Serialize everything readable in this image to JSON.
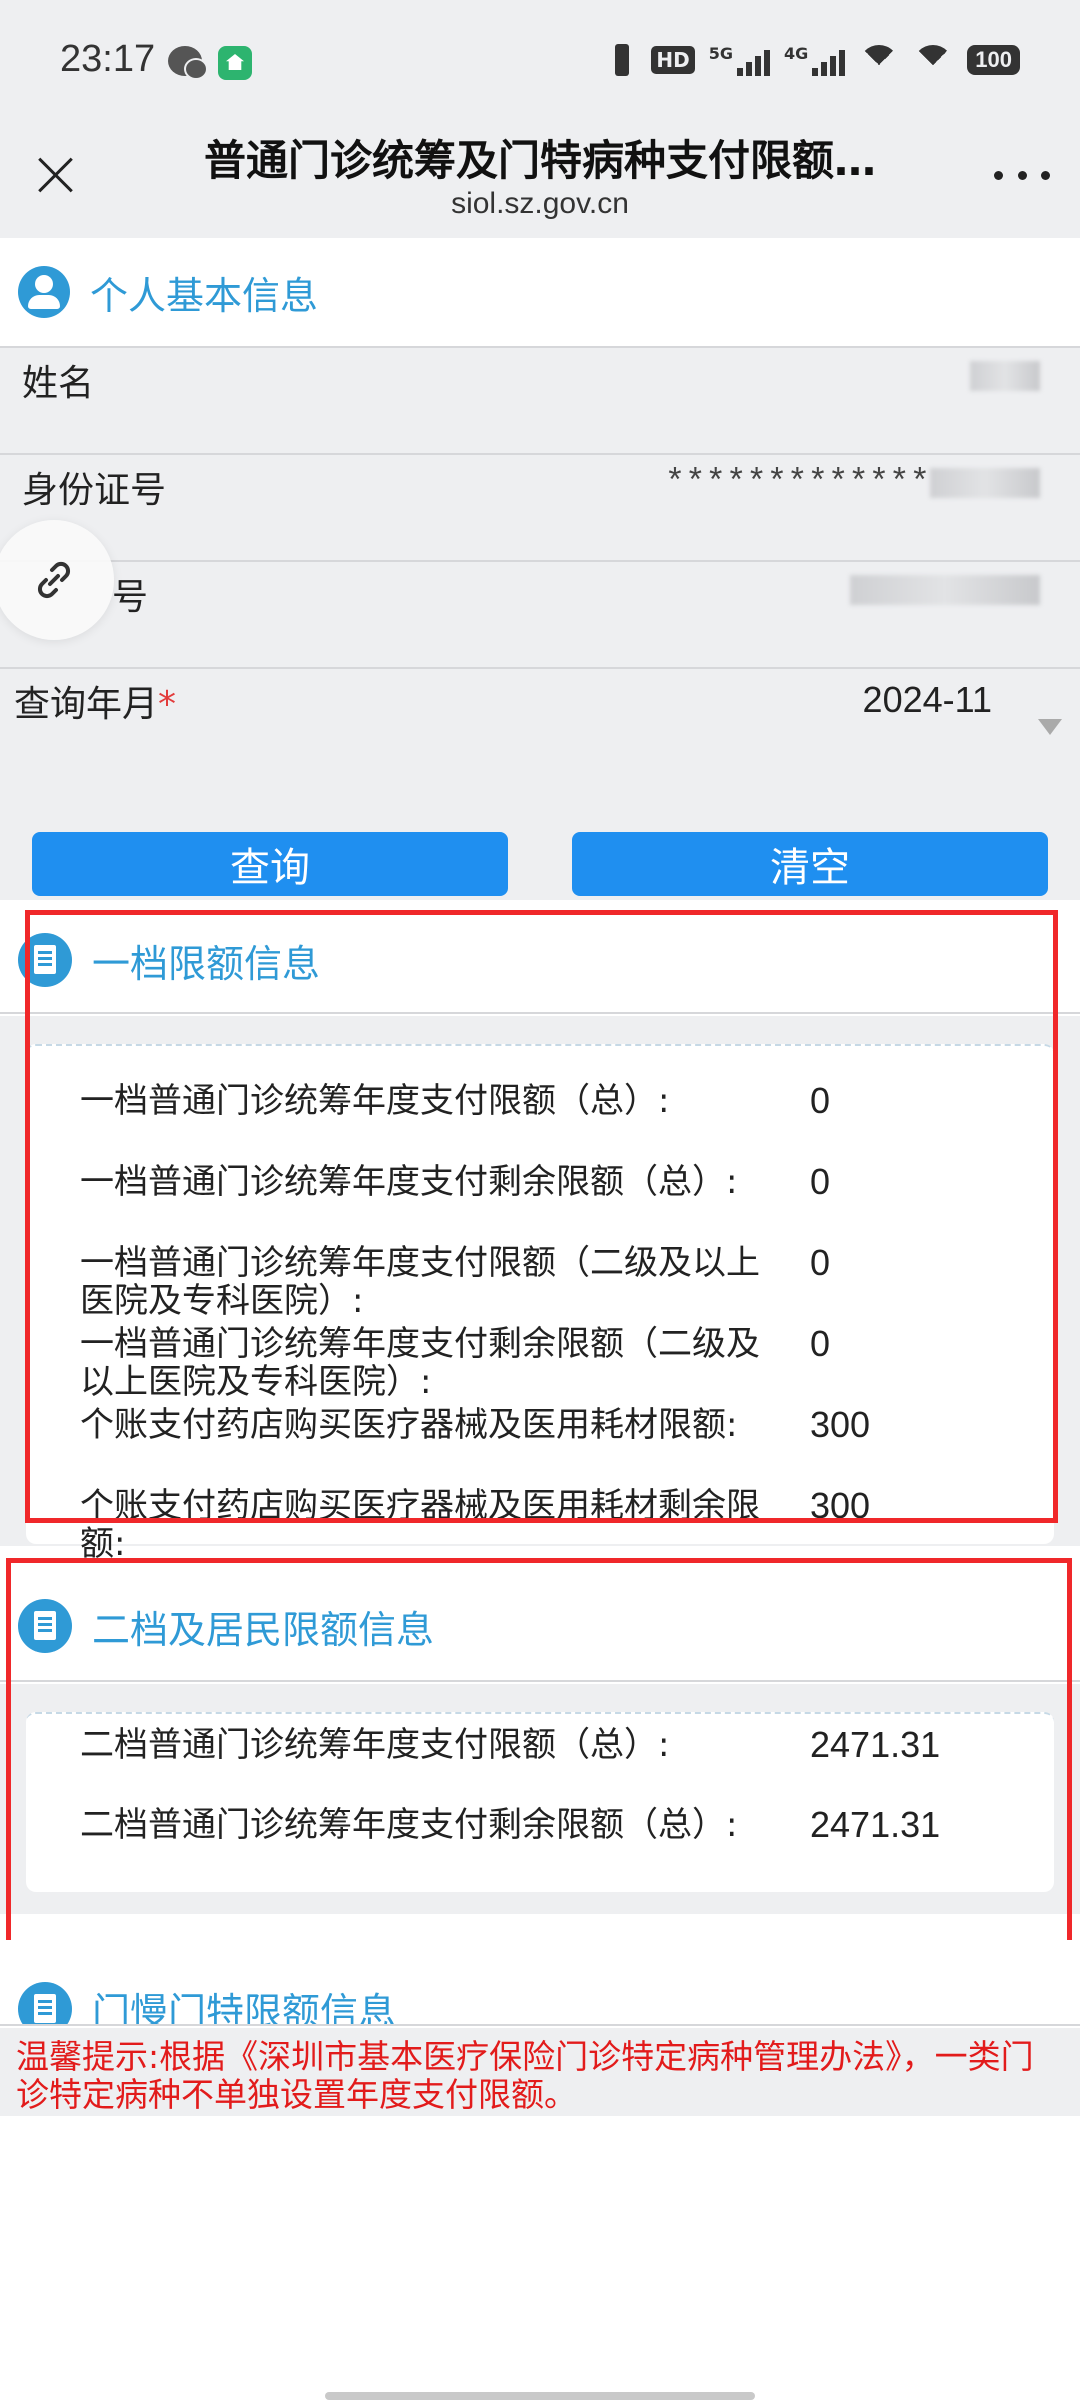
{
  "status_bar": {
    "time": "23:17",
    "hd_label": "HD",
    "net1_label": "5G",
    "net2_label": "4G",
    "battery": "100",
    "icons": [
      "wechat-icon",
      "app-icon",
      "vibrate-icon",
      "hd-icon",
      "signal-icon",
      "wifi-icon",
      "battery-icon"
    ]
  },
  "nav": {
    "title": "普通门诊统筹及门特病种支付限额…",
    "subtitle": "siol.sz.gov.cn"
  },
  "personal": {
    "section_title": "个人基本信息",
    "name_label": "姓名",
    "id_label": "身份证号",
    "id_value_visible": "*************",
    "third_label_visible": "号",
    "month_label": "查询年月",
    "required_mark": "*",
    "month_value": "2024-11"
  },
  "buttons": {
    "query": "查询",
    "clear": "清空"
  },
  "tier1": {
    "section_title": "一档限额信息",
    "rows": [
      {
        "label": "一档普通门诊统筹年度支付限额（总）:",
        "value": "0"
      },
      {
        "label": "一档普通门诊统筹年度支付剩余限额（总）:",
        "value": "0"
      },
      {
        "label": "一档普通门诊统筹年度支付限额（二级及以上医院及专科医院）:",
        "value": "0"
      },
      {
        "label": "一档普通门诊统筹年度支付剩余限额（二级及以上医院及专科医院）:",
        "value": "0"
      },
      {
        "label": "个账支付药店购买医疗器械及医用耗材限额:",
        "value": "300"
      },
      {
        "label": "个账支付药店购买医疗器械及医用耗材剩余限额:",
        "value": "300"
      }
    ]
  },
  "tier2": {
    "section_title": "二档及居民限额信息",
    "rows": [
      {
        "label": "二档普通门诊统筹年度支付限额（总）:",
        "value": "2471.31"
      },
      {
        "label": "二档普通门诊统筹年度支付剩余限额（总）:",
        "value": "2471.31"
      }
    ]
  },
  "chronic": {
    "section_title": "门慢门特限额信息"
  },
  "notice": "温馨提示:根据《深圳市基本医疗保险门诊特定病种管理办法》，一类门诊特定病种不单独设置年度支付限额。",
  "colors": {
    "accent": "#2f9ad6",
    "button": "#1f8ff0",
    "highlight": "#f0282a",
    "notice": "#e21b1b"
  }
}
